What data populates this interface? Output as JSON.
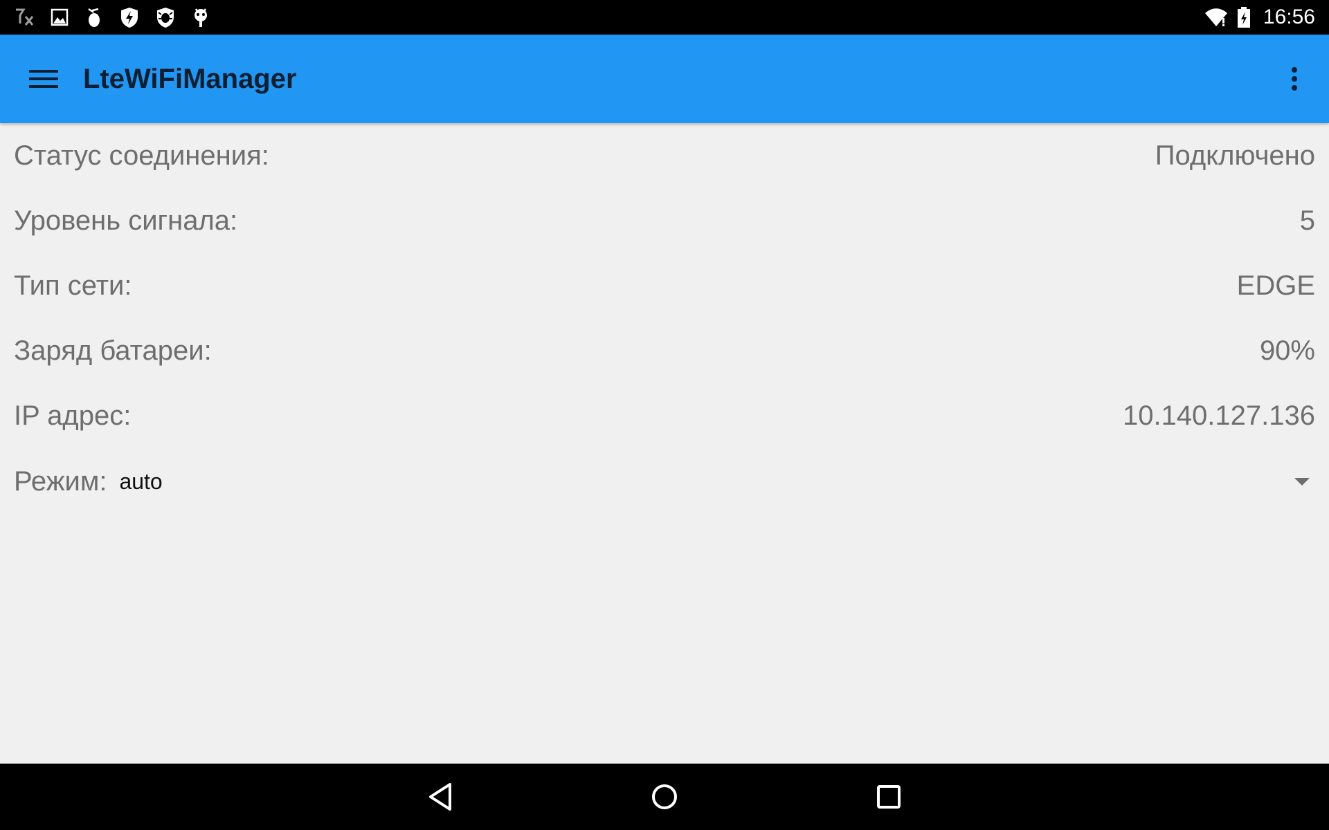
{
  "status_bar": {
    "time": "16:56",
    "left_icons": [
      "no-signal-icon",
      "image-icon",
      "fire-extinguisher-icon",
      "shield-bolt-icon",
      "shield-bug-icon",
      "robot-icon"
    ],
    "right_icons": [
      "wifi-icon",
      "battery-charging-icon"
    ]
  },
  "app_bar": {
    "title": "LteWiFiManager",
    "background_color": "#2196f3"
  },
  "info": {
    "status": {
      "label": "Статус соединения:",
      "value": "Подключено"
    },
    "signal": {
      "label": "Уровень сигнала:",
      "value": "5"
    },
    "network_type": {
      "label": "Тип сети:",
      "value": "EDGE"
    },
    "battery": {
      "label": "Заряд батареи:",
      "value": "90%"
    },
    "ip": {
      "label": "IP адрес:",
      "value": "10.140.127.136"
    }
  },
  "mode": {
    "label": "Режим:",
    "selected": "auto"
  },
  "nav_bar": {
    "buttons": [
      "back-icon",
      "home-icon",
      "recents-icon"
    ]
  }
}
